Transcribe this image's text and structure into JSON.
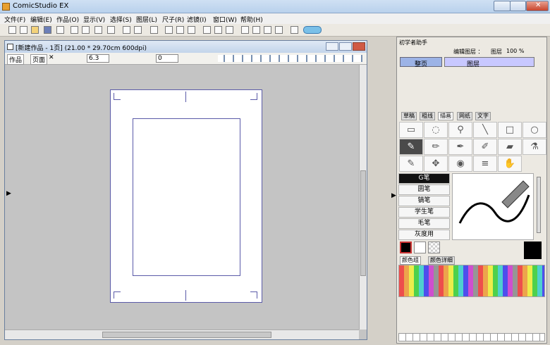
{
  "window": {
    "title": "ComicStudio EX"
  },
  "menu": [
    "文件(F)",
    "编辑(E)",
    "作品(O)",
    "显示(V)",
    "选择(S)",
    "图层(L)",
    "尺子(R)",
    "滤镜(I)",
    "窗口(W)",
    "帮助(H)"
  ],
  "document": {
    "title": "[新建作品 - 1页] (21.00 * 29.70cm 600dpi)",
    "tabs": [
      "作品",
      "页面"
    ],
    "zoom": "6.3",
    "rotation": "0"
  },
  "panel": {
    "assistant_title": "初学者助手",
    "layer_header": "编辑图层 ：",
    "layer_label": "图层",
    "layer_opacity": "100 %",
    "page_item": "整页",
    "layer_item": "图层",
    "tool_tabs": [
      "草稿",
      "粗线",
      "描画",
      "网纸",
      "文字"
    ],
    "brushes": [
      "G笔",
      "圆笔",
      "镝笔",
      "学生笔",
      "毛笔",
      "灰度用"
    ],
    "color_tabs": [
      "颜色组",
      "颜色详细"
    ]
  },
  "colors": {
    "accent": "#9cb3e6",
    "layer_selected": "#c8c8ff"
  }
}
